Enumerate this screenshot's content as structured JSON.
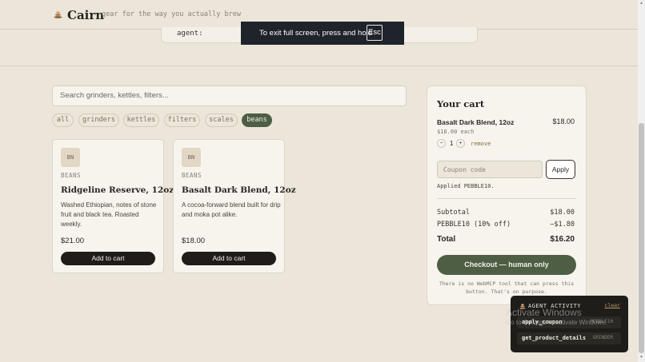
{
  "header": {
    "brand": "Cairn",
    "tagline": "gear for the way you actually brew"
  },
  "agent_snippet": {
    "label": "agent:"
  },
  "fullscreen_toast": {
    "text": "To exit full screen, press and hold",
    "key": "Esc"
  },
  "search": {
    "placeholder": "Search grinders, kettles, filters..."
  },
  "filters": [
    {
      "label": "all",
      "active": false
    },
    {
      "label": "grinders",
      "active": false
    },
    {
      "label": "kettles",
      "active": false
    },
    {
      "label": "filters",
      "active": false
    },
    {
      "label": "scales",
      "active": false
    },
    {
      "label": "beans",
      "active": true
    }
  ],
  "products": [
    {
      "badge": "BN",
      "category": "BEANS",
      "name": "Ridgeline Reserve, 12oz",
      "description": "Washed Ethiopian, notes of stone fruit and black tea. Roasted weekly.",
      "price": "$21.00",
      "button": "Add to cart"
    },
    {
      "badge": "BN",
      "category": "BEANS",
      "name": "Basalt Dark Blend, 12oz",
      "description": "A cocoa-forward blend built for drip and moka pot alike.",
      "price": "$18.00",
      "button": "Add to cart"
    }
  ],
  "cart": {
    "title": "Your cart",
    "item": {
      "name": "Basalt Dark Blend, 12oz",
      "price": "$18.00",
      "each": "$18.00 each",
      "qty": "1",
      "minus": "−",
      "plus": "+",
      "remove": "remove"
    },
    "coupon_placeholder": "Coupon code",
    "apply": "Apply",
    "applied": "Applied PEBBLE10.",
    "subtotal_label": "Subtotal",
    "subtotal_value": "$18.00",
    "discount_label": "PEBBLE10 (10% off)",
    "discount_value": "−$1.80",
    "total_label": "Total",
    "total_value": "$16.20",
    "checkout": "Checkout — human only",
    "note": "There is no WebMCP tool that can press this button. That's on purpose."
  },
  "activity": {
    "title": "AGENT ACTIVITY",
    "clear": "clear",
    "items": [
      {
        "fn": "apply_coupon",
        "tag": "PEBBLE10"
      },
      {
        "fn": "get_product_details",
        "tag": "GRINDER"
      }
    ]
  },
  "watermark": {
    "title": "Activate Windows",
    "subtitle": "Go to Settings to activate Windows."
  },
  "colors": {
    "background": "#ece6da",
    "accent_green": "#4d5e45",
    "dark": "#1f1d1a",
    "card": "#f7f4ee"
  }
}
